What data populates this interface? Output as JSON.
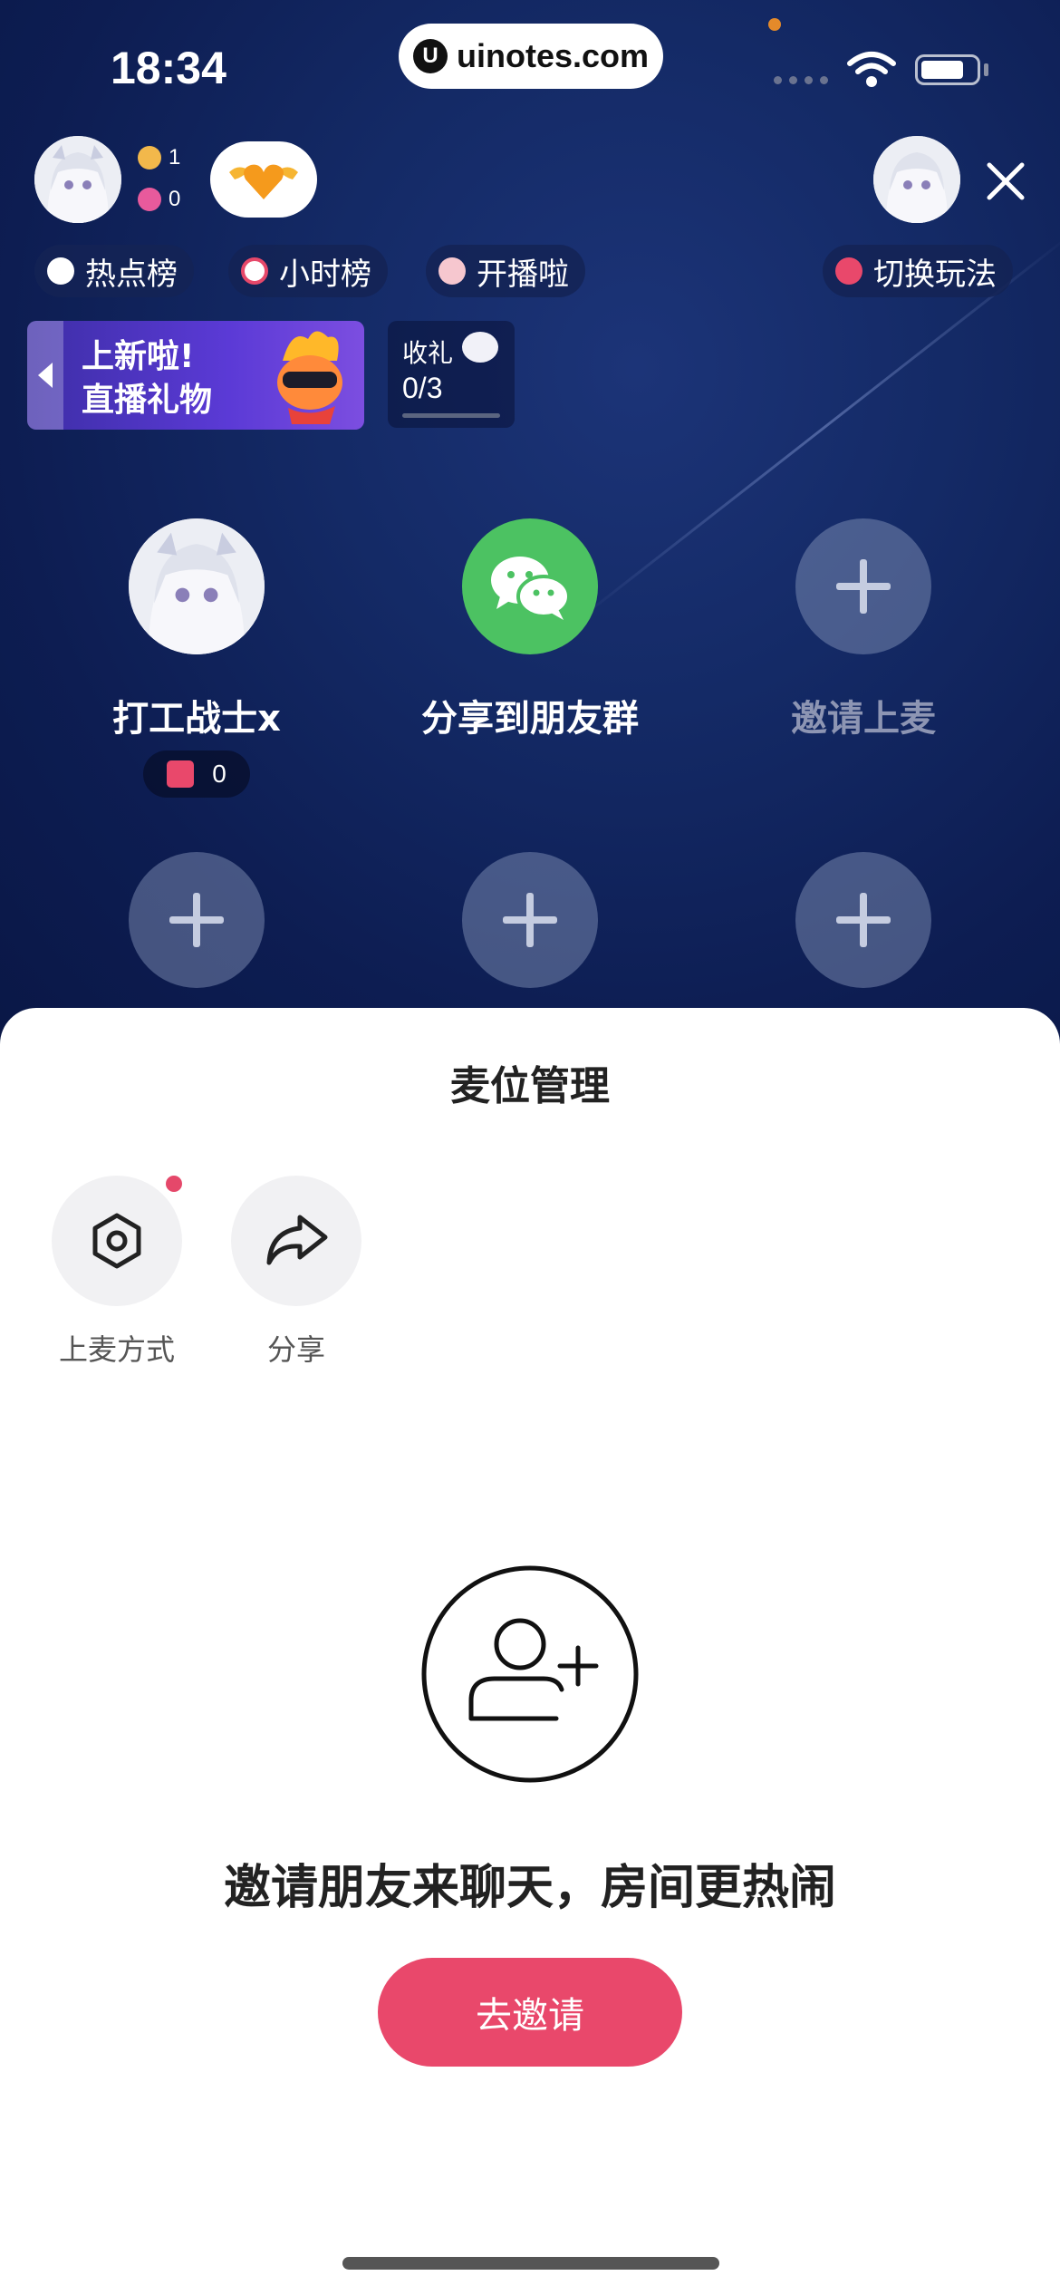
{
  "status_bar": {
    "time": "18:34",
    "url": "uinotes.com",
    "url_logo": "U"
  },
  "header": {
    "online_count": "1",
    "like_count": "0"
  },
  "chips": {
    "hot_list": "热点榜",
    "hour_list": "小时榜",
    "live_start": "开播啦",
    "switch_mode": "切换玩法"
  },
  "banner": {
    "line1": "上新啦!",
    "line2": "直播礼物"
  },
  "gift_task": {
    "label": "收礼",
    "progress_text": "0/3",
    "progress": 0
  },
  "seats": {
    "host_name": "打工战士x",
    "host_gifts": "0",
    "share_label": "分享到朋友群",
    "invite_label": "邀请上麦"
  },
  "sheet": {
    "title": "麦位管理",
    "option_mode": "上麦方式",
    "option_share": "分享",
    "invite_text": "邀请朋友来聊天，房间更热闹",
    "invite_button": "去邀请"
  },
  "colors": {
    "accent": "#e9486b",
    "wechat_green": "#4cc262",
    "background": "#0d1d52"
  },
  "icons": [
    "wifi-icon",
    "battery-icon",
    "close-icon",
    "fire-icon",
    "clock-icon",
    "chat-icon",
    "switch-icon",
    "wechat-icon",
    "plus-icon",
    "gift-icon",
    "gear-icon",
    "share-arrow-icon",
    "add-user-icon",
    "heart-icon"
  ]
}
